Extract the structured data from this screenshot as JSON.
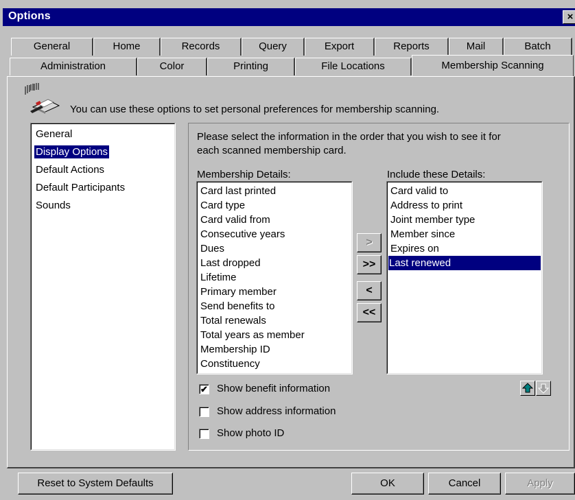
{
  "window": {
    "title": "Options",
    "close_glyph": "×"
  },
  "tabs_row1": [
    {
      "label": "General",
      "key": "G"
    },
    {
      "label": "Home",
      "key": "H"
    },
    {
      "label": "Records",
      "key": "R"
    },
    {
      "label": "Query",
      "key": "Q"
    },
    {
      "label": "Export",
      "key": "E"
    },
    {
      "label": "Reports",
      "key": "t"
    },
    {
      "label": "Mail",
      "key": "M"
    },
    {
      "label": "Batch",
      "key": "B"
    }
  ],
  "tabs_row2": [
    {
      "label": "Administration",
      "key": "A"
    },
    {
      "label": "Color",
      "key": "o"
    },
    {
      "label": "Printing",
      "key": "P"
    },
    {
      "label": "File Locations",
      "key": "F"
    },
    {
      "label": "Membership Scanning",
      "key": "S",
      "selected": true
    }
  ],
  "header": {
    "icon": "barcode-scanner-icon",
    "description": "You can use these options to set personal preferences for membership scanning."
  },
  "nav": {
    "items": [
      "General",
      "Display Options",
      "Default Actions",
      "Default Participants",
      "Sounds"
    ],
    "selected_index": 1
  },
  "panel": {
    "instructions_line1": "Please select the information in the order that you wish to see it for",
    "instructions_line2": "each scanned membership card.",
    "available_label": "Membership Details:",
    "included_label": "Include these Details:",
    "available": [
      "Card last printed",
      "Card type",
      "Card valid from",
      "Consecutive years",
      "Dues",
      "Last dropped",
      "Lifetime",
      "Primary member",
      "Send benefits to",
      "Total renewals",
      "Total years as member",
      "Membership ID",
      "Constituency"
    ],
    "included": [
      "Card valid to",
      "Address to print",
      "Joint member type",
      "Member since",
      "Expires on",
      "Last renewed"
    ],
    "included_selected_index": 5,
    "move_buttons": {
      "add_one": ">",
      "add_all": ">>",
      "remove_one": "<",
      "remove_all": "<<"
    },
    "checkboxes": [
      {
        "label": "Show benefit information",
        "checked": true,
        "check_glyph": "✔"
      },
      {
        "label": "Show address information",
        "checked": false,
        "check_glyph": ""
      },
      {
        "label": "Show photo ID",
        "checked": false,
        "check_glyph": ""
      }
    ],
    "move_up_icon": "arrow-up-icon",
    "move_down_icon": "arrow-down-icon"
  },
  "footer": {
    "reset_label": "Reset to System Defaults",
    "ok_label": "OK",
    "cancel_label": "Cancel",
    "apply_label": "Apply"
  }
}
